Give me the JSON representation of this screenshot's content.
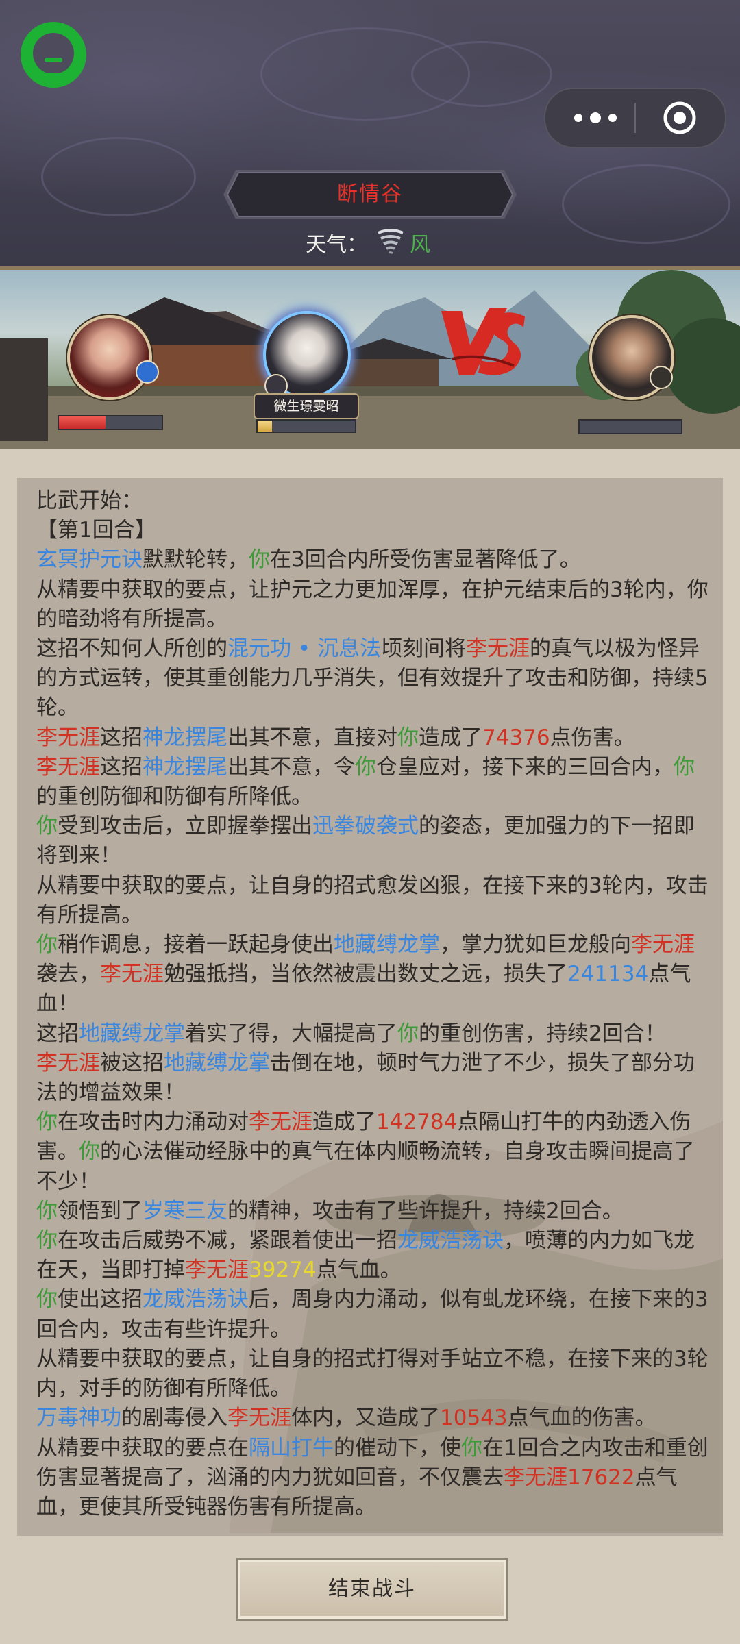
{
  "header": {
    "location": "断情谷",
    "weather_label": "天气：",
    "weather_value": "风",
    "weather_icon": "tornado-icon"
  },
  "battle": {
    "ally_name": "微生璟雯昭",
    "vs_text": "VS",
    "player_hp_fraction": 0.45,
    "ally_hp_fraction": 0.15,
    "enemy_hp_fraction": 0.0
  },
  "log": [
    {
      "segs": [
        {
          "t": "比武开始："
        }
      ]
    },
    {
      "segs": [
        {
          "t": "【第1回合】"
        }
      ]
    },
    {
      "segs": [
        {
          "t": "玄冥护元诀",
          "c": "s"
        },
        {
          "t": "默默轮转，"
        },
        {
          "t": "你",
          "c": "y"
        },
        {
          "t": "在3回合内所受伤害显著降低了。"
        }
      ]
    },
    {
      "segs": [
        {
          "t": "从精要中获取的要点，让护元之力更加浑厚，在护元结束后的3轮内，你的暗劲将有所提高。"
        }
      ]
    },
    {
      "segs": [
        {
          "t": "这招不知何人所创的"
        },
        {
          "t": "混元功 • 沉息法",
          "c": "s"
        },
        {
          "t": "顷刻间将"
        },
        {
          "t": "李无涯",
          "c": "e"
        },
        {
          "t": "的真气以极为怪异的方式运转，使其重创能力几乎消失，但有效提升了攻击和防御，持续5轮。"
        }
      ]
    },
    {
      "segs": [
        {
          "t": "李无涯",
          "c": "e"
        },
        {
          "t": "这招"
        },
        {
          "t": "神龙摆尾",
          "c": "s"
        },
        {
          "t": "出其不意，直接对"
        },
        {
          "t": "你",
          "c": "y"
        },
        {
          "t": "造成了"
        },
        {
          "t": "74376",
          "c": "n"
        },
        {
          "t": "点伤害。"
        }
      ]
    },
    {
      "segs": [
        {
          "t": "李无涯",
          "c": "e"
        },
        {
          "t": "这招"
        },
        {
          "t": "神龙摆尾",
          "c": "s"
        },
        {
          "t": "出其不意，令"
        },
        {
          "t": "你",
          "c": "y"
        },
        {
          "t": "仓皇应对，接下来的三回合内，"
        },
        {
          "t": "你",
          "c": "y"
        },
        {
          "t": "的重创防御和防御有所降低。"
        }
      ]
    },
    {
      "segs": [
        {
          "t": "你",
          "c": "y"
        },
        {
          "t": "受到攻击后，立即握拳摆出"
        },
        {
          "t": "迅拳破袭式",
          "c": "s"
        },
        {
          "t": "的姿态，更加强力的下一招即将到来！"
        }
      ]
    },
    {
      "segs": [
        {
          "t": "从精要中获取的要点，让自身的招式愈发凶狠，在接下来的3轮内，攻击有所提高。"
        }
      ]
    },
    {
      "segs": [
        {
          "t": "你",
          "c": "y"
        },
        {
          "t": "稍作调息，接着一跃起身使出"
        },
        {
          "t": "地藏缚龙掌",
          "c": "s"
        },
        {
          "t": "，掌力犹如巨龙般向"
        },
        {
          "t": "李无涯",
          "c": "e"
        },
        {
          "t": "袭去，"
        },
        {
          "t": "李无涯",
          "c": "e"
        },
        {
          "t": "勉强抵挡，当依然被震出数丈之远，损失了"
        },
        {
          "t": "241134",
          "c": "s"
        },
        {
          "t": "点气血！"
        }
      ]
    },
    {
      "segs": [
        {
          "t": "这招"
        },
        {
          "t": "地藏缚龙掌",
          "c": "s"
        },
        {
          "t": "着实了得，大幅提高了"
        },
        {
          "t": "你",
          "c": "y"
        },
        {
          "t": "的重创伤害，持续2回合！"
        }
      ]
    },
    {
      "segs": [
        {
          "t": "李无涯",
          "c": "e"
        },
        {
          "t": "被这招"
        },
        {
          "t": "地藏缚龙掌",
          "c": "s"
        },
        {
          "t": "击倒在地，顿时气力泄了不少，损失了部分功法的增益效果！"
        }
      ]
    },
    {
      "segs": [
        {
          "t": "你",
          "c": "y"
        },
        {
          "t": "在攻击时内力涌动对"
        },
        {
          "t": "李无涯",
          "c": "e"
        },
        {
          "t": "造成了"
        },
        {
          "t": "142784",
          "c": "n"
        },
        {
          "t": "点隔山打牛的内劲透入伤害。"
        },
        {
          "t": "你",
          "c": "y"
        },
        {
          "t": "的心法催动经脉中的真气在体内顺畅流转，自身攻击瞬间提高了不少！"
        }
      ]
    },
    {
      "segs": [
        {
          "t": "你",
          "c": "y"
        },
        {
          "t": "领悟到了"
        },
        {
          "t": "岁寒三友",
          "c": "s"
        },
        {
          "t": "的精神，攻击有了些许提升，持续2回合。"
        }
      ]
    },
    {
      "segs": [
        {
          "t": "你",
          "c": "y"
        },
        {
          "t": "在攻击后威势不减，紧跟着使出一招"
        },
        {
          "t": "龙威浩荡诀",
          "c": "s"
        },
        {
          "t": "，喷薄的内力如飞龙在天，当即打掉"
        },
        {
          "t": "李无涯",
          "c": "e"
        },
        {
          "t": "39274",
          "c": "g"
        },
        {
          "t": "点气血。"
        }
      ]
    },
    {
      "segs": [
        {
          "t": "你",
          "c": "y"
        },
        {
          "t": "使出这招"
        },
        {
          "t": "龙威浩荡诀",
          "c": "s"
        },
        {
          "t": "后，周身内力涌动，似有虬龙环绕，在接下来的3回合内，攻击有些许提升。"
        }
      ]
    },
    {
      "segs": [
        {
          "t": "从精要中获取的要点，让自身的招式打得对手站立不稳，在接下来的3轮内，对手的防御有所降低。"
        }
      ]
    },
    {
      "segs": [
        {
          "t": "万毒神功",
          "c": "s"
        },
        {
          "t": "的剧毒侵入"
        },
        {
          "t": "李无涯",
          "c": "e"
        },
        {
          "t": "体内，又造成了"
        },
        {
          "t": "10543",
          "c": "n"
        },
        {
          "t": "点气血的伤害。"
        }
      ]
    },
    {
      "segs": [
        {
          "t": "从精要中获取的要点在"
        },
        {
          "t": "隔山打牛",
          "c": "s"
        },
        {
          "t": "的催动下，使"
        },
        {
          "t": "你",
          "c": "y"
        },
        {
          "t": "在1回合之内攻击和重创伤害显著提高了，汹涌的内力犹如回音，不仅震去"
        },
        {
          "t": "李无涯",
          "c": "e"
        },
        {
          "t": "17622",
          "c": "n"
        },
        {
          "t": "点气血，更使其所受钝器伤害有所提高。"
        }
      ]
    }
  ],
  "footer": {
    "end_label": "结束战斗"
  }
}
